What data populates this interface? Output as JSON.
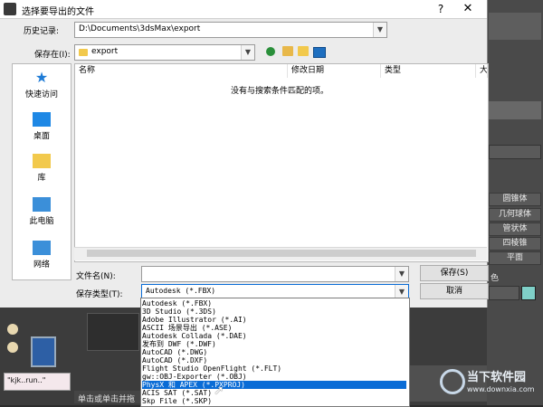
{
  "dialog": {
    "title": "选择要导出的文件",
    "help_glyph": "?",
    "close_glyph": "✕",
    "history_label": "历史记录:",
    "history_value": "D:\\Documents\\3dsMax\\export",
    "save_in_label": "保存在(I):",
    "save_in_value": "export",
    "places": [
      {
        "label": "快速访问"
      },
      {
        "label": "桌面"
      },
      {
        "label": "库"
      },
      {
        "label": "此电脑"
      },
      {
        "label": "网络"
      }
    ],
    "columns": [
      "名称",
      "修改日期",
      "类型",
      "大"
    ],
    "empty_message": "没有与搜索条件匹配的项。",
    "filename_label": "文件名(N):",
    "filename_value": "",
    "filetype_label": "保存类型(T):",
    "filetype_value": "Autodesk (*.FBX)",
    "save_button": "保存(S)",
    "cancel_button": "取消",
    "filetype_options": [
      "Autodesk (*.FBX)",
      "3D Studio (*.3DS)",
      "Adobe Illustrator (*.AI)",
      "ASCII 场景导出 (*.ASE)",
      "Autodesk Collada (*.DAE)",
      "发布到 DWF (*.DWF)",
      "AutoCAD (*.DWG)",
      "AutoCAD (*.DXF)",
      "Flight Studio OpenFlight (*.FLT)",
      "gw::OBJ-Exporter (*.OBJ)",
      "PhysX 和 APEX (*.PXPROJ)",
      "ACIS SAT (*.SAT)",
      "Skp File (*.SKP)"
    ],
    "selected_option_index": 10
  },
  "max_ui": {
    "right_panel_buttons": [
      "圆锥体",
      "几何球体",
      "管状体",
      "四棱锥",
      "平面"
    ],
    "color_label": "色",
    "status_text": "单击或单击并拖",
    "script_text": "\"kjk..run..\""
  },
  "watermark": {
    "text": "当下软件园",
    "url": "www.downxia.com"
  },
  "colors": {
    "accent": "#0a6cd6",
    "dialog_bg": "#ececec",
    "max_bg": "#3c3c3c"
  }
}
